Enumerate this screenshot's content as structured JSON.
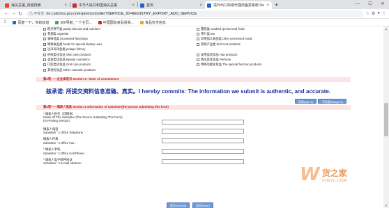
{
  "browser": {
    "tabs": [
      {
        "label": "海关总署_百度搜索",
        "fav_color": "#e94235",
        "active": false
      },
      {
        "label": "中华人民共和国海关总署",
        "fav_color": "#c92a2a",
        "active": false
      },
      {
        "label": "首页",
        "fav_color": "#2a62c9",
        "active": false
      },
      {
        "label": "境外出口商或代理商备案系统 Re",
        "fav_color": "#2a62c9",
        "active": true
      }
    ],
    "new_tab": "+",
    "window_controls": [
      "—",
      "☐",
      "✕"
    ],
    "security_label": "⚠ 不安全",
    "url": "ire.customs.gov.cn/expire/controller?SERVICE_ID=REGISTRY_EXPORT_ADD_SERVICE",
    "bookmarks": [
      {
        "label": "百度一下，你就知道",
        "color": "#2a62c9"
      },
      {
        "label": "360导航_一个主页...",
        "color": "#2fae4e"
      },
      {
        "label": "中国国际食品贸易...",
        "color": "#c92a2a"
      },
      {
        "label": "食品安全信息",
        "color": "#e9a035"
      }
    ]
  },
  "checkbox_rows": [
    [
      "糕点饼干类 pastry biscuits and crackers",
      "蜜饯类 candied (preserved) fruits"
    ],
    [
      "卷烟类 cigarette",
      "茶叶类 tea"
    ],
    [
      "调味品类 processed flavorings",
      "其他加工食品类 other processed foods"
    ],
    [
      "特殊食品类 foods for special dietary uses",
      "燕窝产品类 bird nest products"
    ],
    [
      "远洋海洋鱼类 pelagic fishery",
      ""
    ],
    [
      "护肤类化妆品 Skin care products",
      "发用类化妆品 Hair products"
    ],
    [
      "美容类化妆品 Beauty cosmetics",
      "香水类化妆品 Perfume"
    ],
    [
      "口腔类化妆品 Oral care products",
      "特殊功能化妆品 The special function products"
    ],
    [
      "其他化妆品 Other cosmetic products",
      ""
    ]
  ],
  "section3": {
    "title": "第3项——企业承诺书 Section 3---letter of commitment",
    "commitment": "兹承诺: 所提交资料信息准确、真实。I hereby commits: The information we submit is authentic, and accurate.",
    "agree_label": "同意(Agree)",
    "disagree_label": "不同意(Disagree)"
  },
  "section4": {
    "title": "第4项——填表人信息 Section 4 Information of submitter(the person submitting this form)",
    "fields": [
      {
        "lines": [
          "* 填表人姓名（印刷体）",
          "Name Of The Submitter (The Person Submitting This Form)",
          "(In Printing Version) :"
        ]
      },
      {
        "lines": [
          "填表人电话",
          "Submitter  ' s Office Telephone :"
        ]
      },
      {
        "lines": [
          "填表人传真",
          "Submitter  ' s Office Fax :"
        ]
      },
      {
        "lines": [
          "* 填表人手机",
          "Submitter  ' s Office Cell Phone :"
        ]
      },
      {
        "lines": [
          "* 填表人电子邮件地址",
          "Submitter  ' s E-mail Address :"
        ]
      }
    ],
    "submit_label": "提交(Submit)",
    "back_label": "返回(Back)"
  },
  "watermark": {
    "logo": "W",
    "name": "货之家",
    "url": "51W2C.COM"
  }
}
